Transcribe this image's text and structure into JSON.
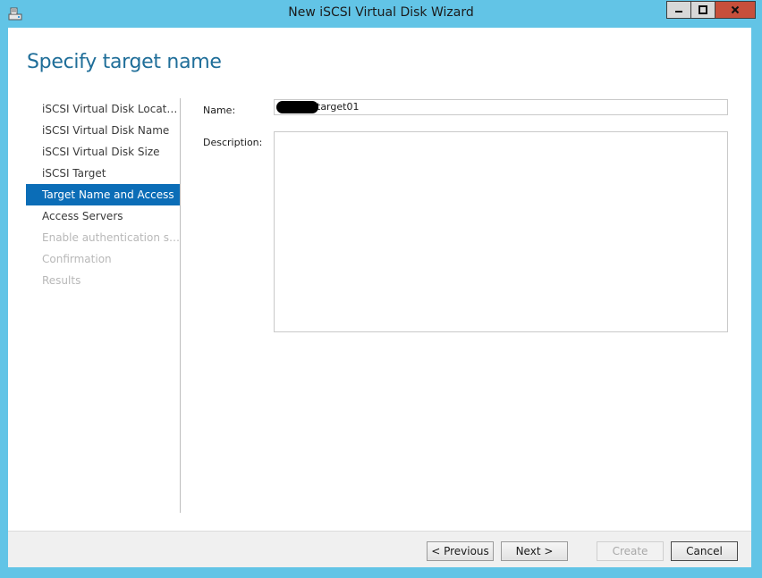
{
  "window": {
    "title": "New iSCSI Virtual Disk Wizard",
    "app_icon": "disk-wizard-icon",
    "controls": {
      "minimize_icon": "minimize-icon",
      "maximize_icon": "maximize-icon",
      "close_icon": "close-icon"
    }
  },
  "page": {
    "title": "Specify target name"
  },
  "nav": {
    "items": [
      {
        "label": "iSCSI Virtual Disk Location",
        "state": "normal"
      },
      {
        "label": "iSCSI Virtual Disk Name",
        "state": "normal"
      },
      {
        "label": "iSCSI Virtual Disk Size",
        "state": "normal"
      },
      {
        "label": "iSCSI Target",
        "state": "normal"
      },
      {
        "label": "Target Name and Access",
        "state": "active"
      },
      {
        "label": "Access Servers",
        "state": "normal"
      },
      {
        "label": "Enable authentication ser...",
        "state": "disabled"
      },
      {
        "label": "Confirmation",
        "state": "disabled"
      },
      {
        "label": "Results",
        "state": "disabled"
      }
    ]
  },
  "form": {
    "name_label": "Name:",
    "name_value": "target01",
    "description_label": "Description:",
    "description_value": ""
  },
  "footer": {
    "previous_label": "< Previous",
    "next_label": "Next >",
    "create_label": "Create",
    "cancel_label": "Cancel"
  },
  "colors": {
    "frame": "#62c4e6",
    "title_accent": "#1f6e99",
    "nav_active": "#0b6db7",
    "close_button": "#c74f3b"
  }
}
